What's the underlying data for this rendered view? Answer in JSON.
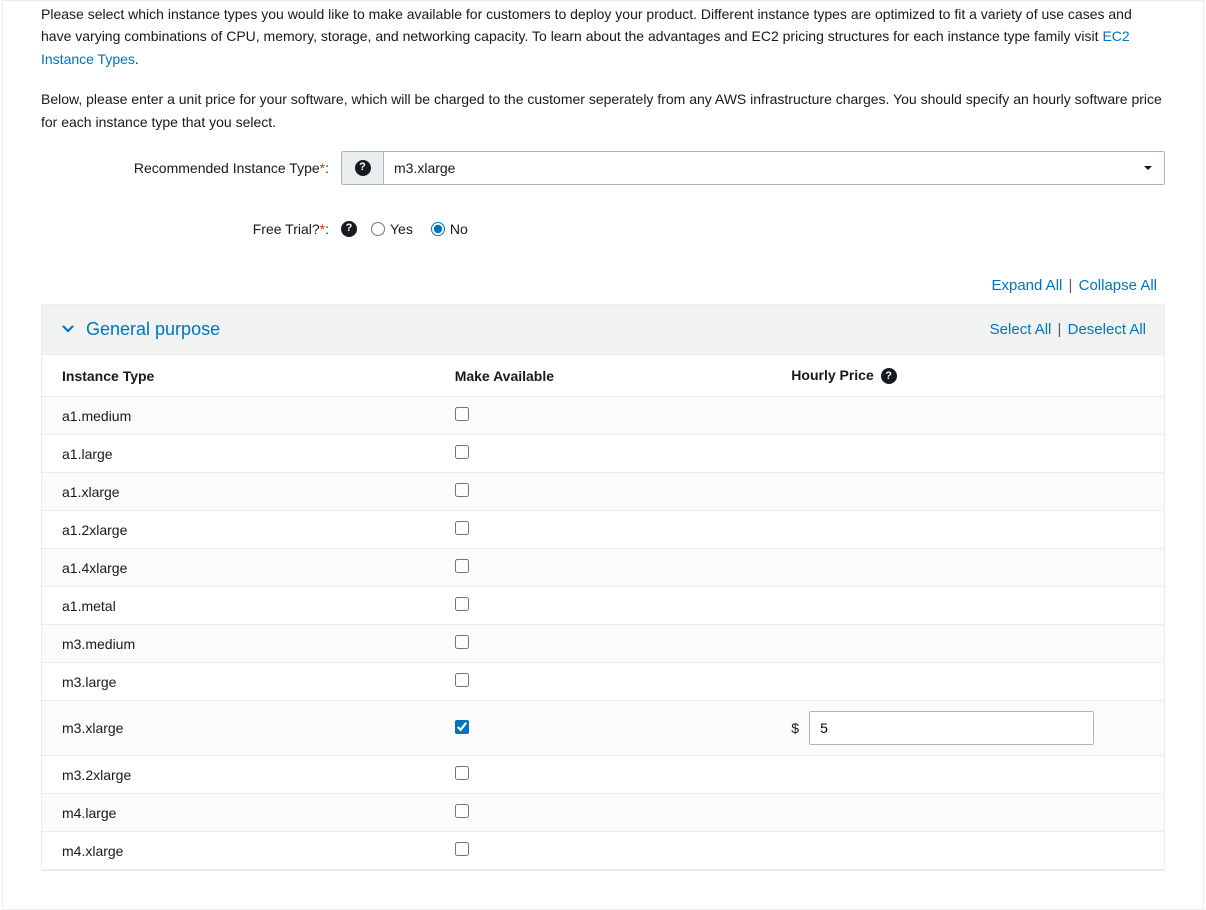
{
  "intro": {
    "p1_a": "Please select which instance types you would like to make available for customers to deploy your product. Different instance types are optimized to fit a variety of use cases and have varying combinations of CPU, memory, storage, and networking capacity. To learn about the advantages and EC2 pricing structures for each instance type family visit ",
    "p1_link": "EC2 Instance Types",
    "p1_b": ".",
    "p2": "Below, please enter a unit price for your software, which will be charged to the customer seperately from any AWS infrastructure charges. You should specify an hourly software price for each instance type that you select."
  },
  "form": {
    "recommended": {
      "label": "Recommended Instance Type",
      "value": "m3.xlarge"
    },
    "free_trial": {
      "label": "Free Trial?",
      "yes": "Yes",
      "no": "No",
      "selected": "no"
    }
  },
  "controls": {
    "expand_all": "Expand All",
    "collapse_all": "Collapse All",
    "select_all": "Select All",
    "deselect_all": "Deselect All"
  },
  "category": {
    "title": "General purpose"
  },
  "table": {
    "headers": {
      "type": "Instance Type",
      "available": "Make Available",
      "price": "Hourly Price"
    },
    "rows": [
      {
        "type": "a1.medium",
        "available": false,
        "price": ""
      },
      {
        "type": "a1.large",
        "available": false,
        "price": ""
      },
      {
        "type": "a1.xlarge",
        "available": false,
        "price": ""
      },
      {
        "type": "a1.2xlarge",
        "available": false,
        "price": ""
      },
      {
        "type": "a1.4xlarge",
        "available": false,
        "price": ""
      },
      {
        "type": "a1.metal",
        "available": false,
        "price": ""
      },
      {
        "type": "m3.medium",
        "available": false,
        "price": ""
      },
      {
        "type": "m3.large",
        "available": false,
        "price": ""
      },
      {
        "type": "m3.xlarge",
        "available": true,
        "price": "5"
      },
      {
        "type": "m3.2xlarge",
        "available": false,
        "price": ""
      },
      {
        "type": "m4.large",
        "available": false,
        "price": ""
      },
      {
        "type": "m4.xlarge",
        "available": false,
        "price": ""
      }
    ]
  },
  "misc": {
    "currency_symbol": "$",
    "separator": "|",
    "required_mark": "*",
    "colon": ":",
    "help_glyph": "?"
  }
}
